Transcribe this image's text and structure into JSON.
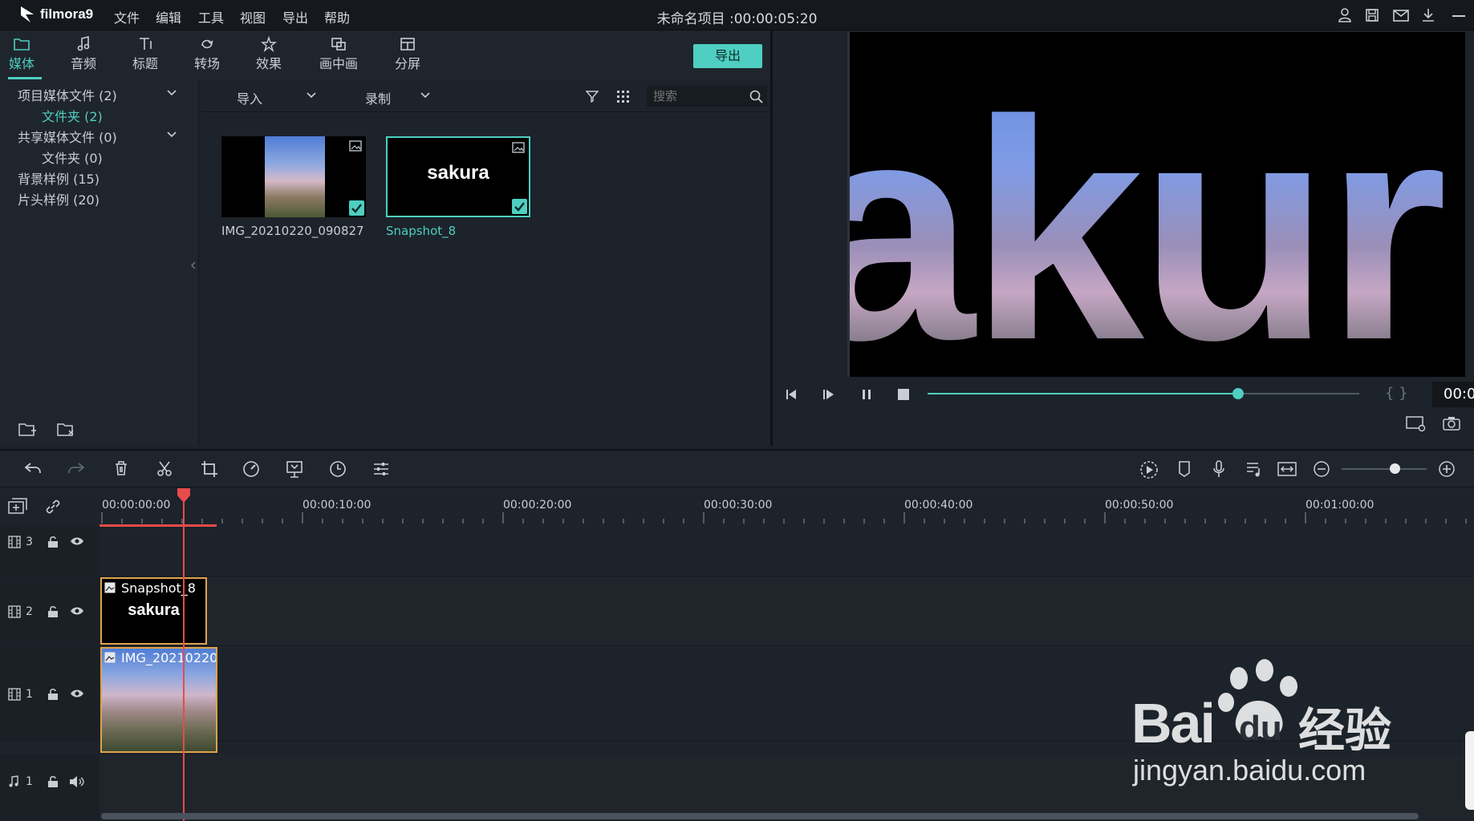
{
  "app": {
    "logo_text": "filmora9",
    "menu": [
      "文件",
      "编辑",
      "工具",
      "视图",
      "导出",
      "帮助"
    ],
    "title": "未命名项目 :00:00:05:20"
  },
  "tabs": [
    {
      "label": "媒体",
      "icon": "folder-icon",
      "active": true
    },
    {
      "label": "音频",
      "icon": "music-note-icon"
    },
    {
      "label": "标题",
      "icon": "text-title-icon"
    },
    {
      "label": "转场",
      "icon": "transition-icon"
    },
    {
      "label": "效果",
      "icon": "effects-icon"
    },
    {
      "label": "画中画",
      "icon": "pip-icon"
    },
    {
      "label": "分屏",
      "icon": "split-screen-icon"
    }
  ],
  "export_button": "导出",
  "library": [
    {
      "label": "项目媒体文件 (2)",
      "expandable": true
    },
    {
      "label": "文件夹 (2)",
      "selected": true
    },
    {
      "label": "共享媒体文件 (0)",
      "expandable": true
    },
    {
      "label": "文件夹 (0)"
    },
    {
      "label": "背景样例 (15)"
    },
    {
      "label": "片头样例 (20)"
    }
  ],
  "media_toolbar": {
    "import_label": "导入",
    "record_label": "录制",
    "search_placeholder": "搜索"
  },
  "media_items": [
    {
      "name": "IMG_20210220_090827",
      "checked": true
    },
    {
      "name": "Snapshot_8",
      "thumb_text": "sakura",
      "checked": true,
      "selected": true
    }
  ],
  "preview": {
    "display_text": "akur",
    "timecode": "00:0",
    "progress": 0.72,
    "bracket_text": "{ }"
  },
  "timeline": {
    "ruler_labels": [
      "00:00:00:00",
      "00:00:10:00",
      "00:00:20:00",
      "00:00:30:00",
      "00:00:40:00",
      "00:00:50:00",
      "00:01:00:00"
    ],
    "tracks": [
      {
        "number": "3",
        "kind": "video"
      },
      {
        "number": "2",
        "kind": "video",
        "clip_name": "Snapshot_8",
        "clip_text": "sakura"
      },
      {
        "number": "1",
        "kind": "video",
        "clip_name": "IMG_20210220"
      },
      {
        "number": "1",
        "kind": "audio"
      }
    ],
    "zoom_level": 0.62
  },
  "watermark": {
    "brand": "Bai",
    "brand2": "du",
    "cn": "经验",
    "url": "jingyan.baidu.com"
  },
  "colors": {
    "accent": "#4ecfc1",
    "playhead": "#e84b4b",
    "clip_border": "#e0a24a",
    "background": "#1d232a"
  }
}
